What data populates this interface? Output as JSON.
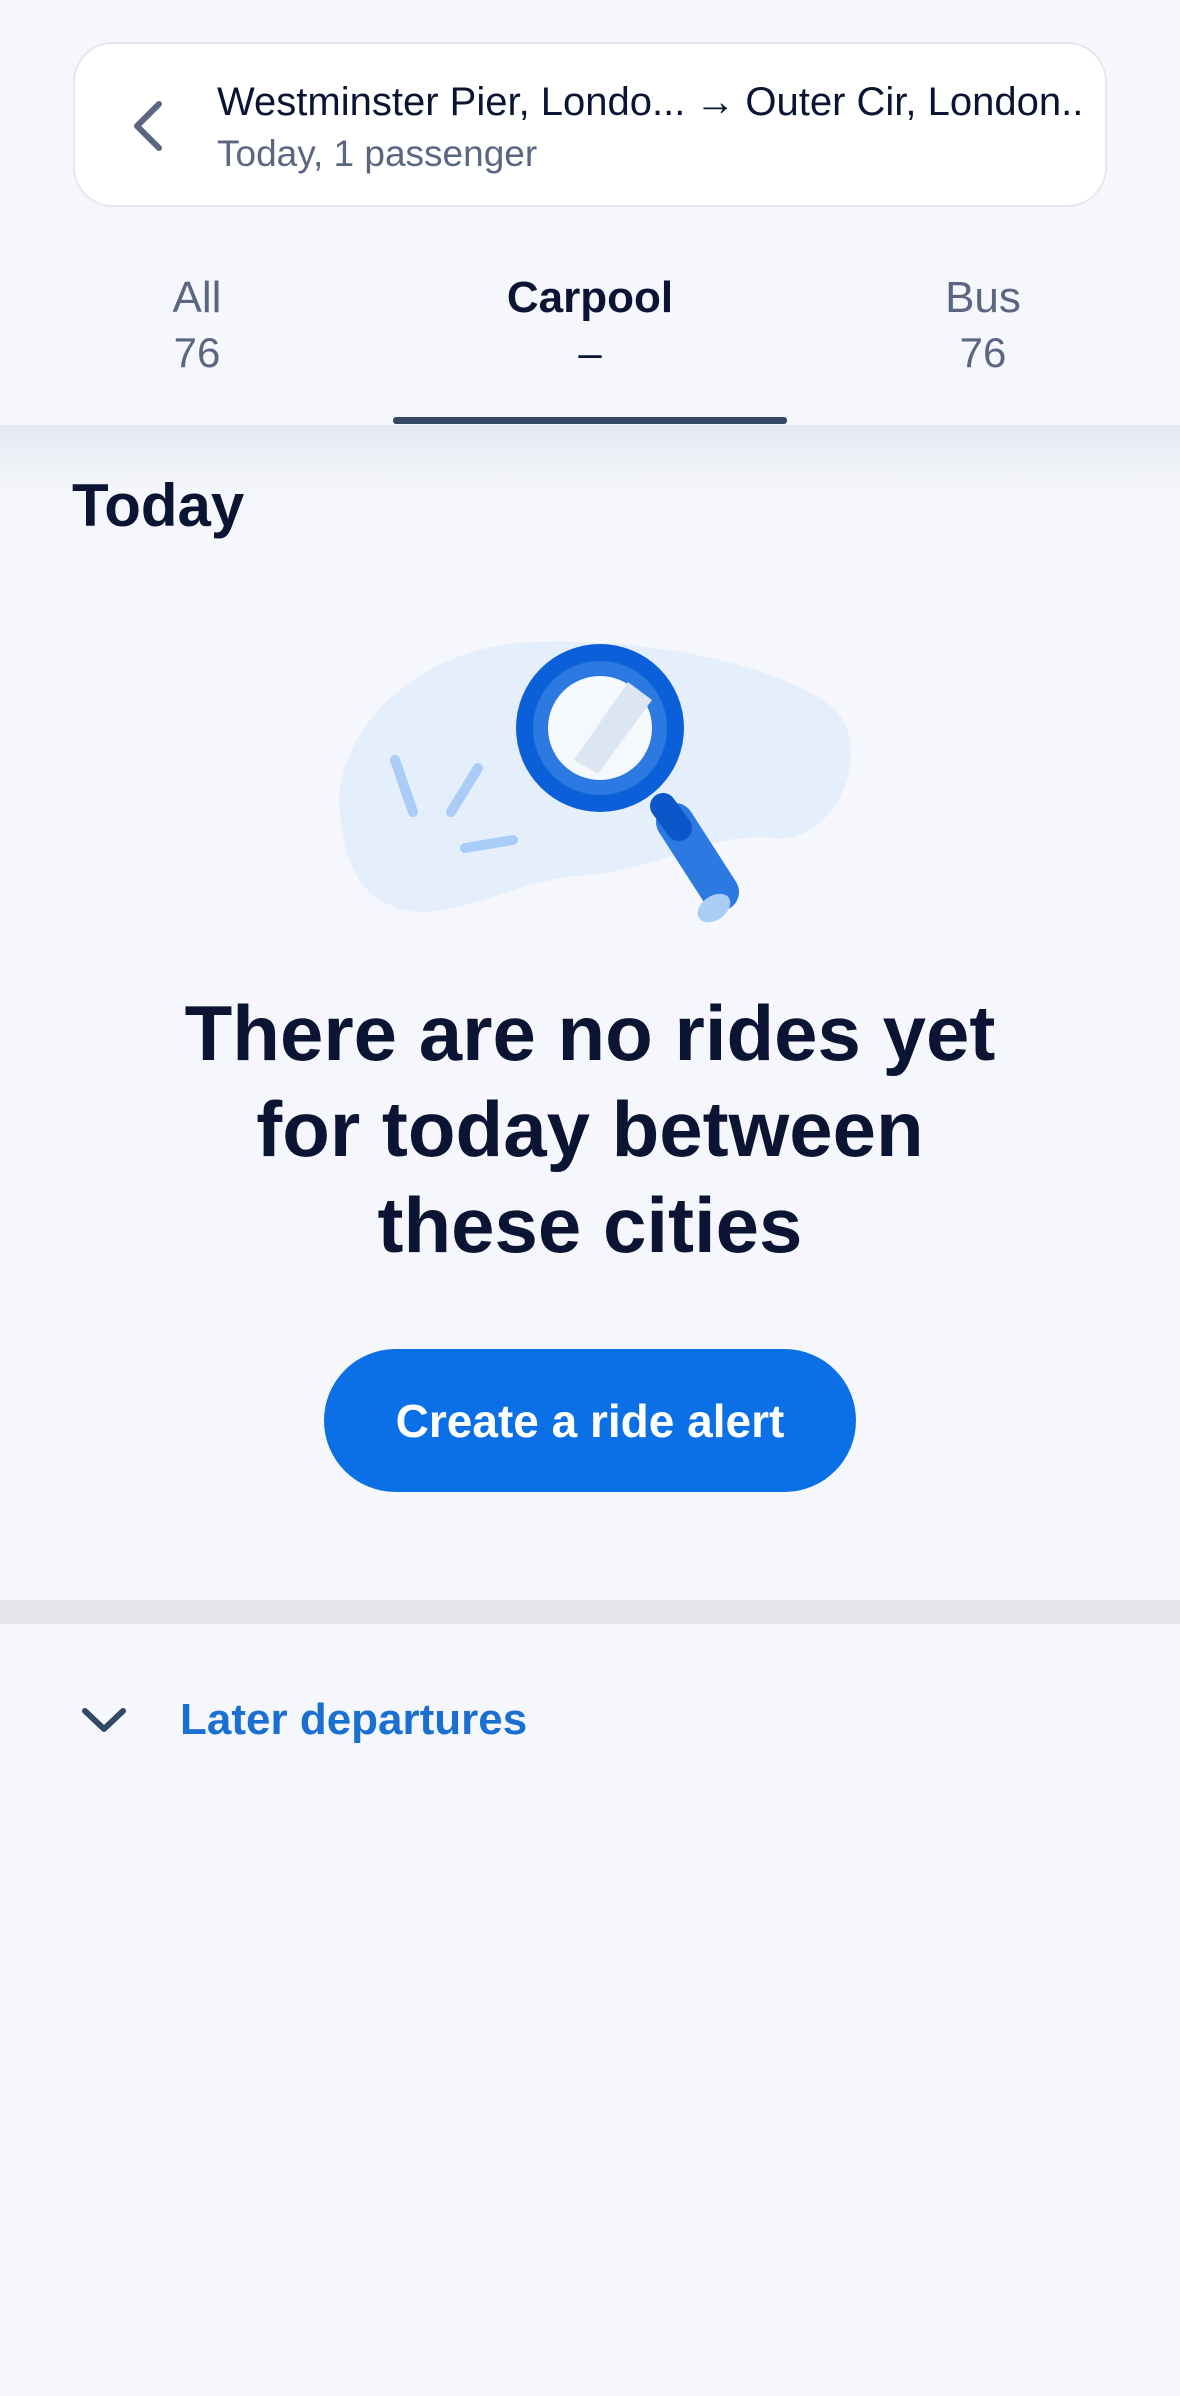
{
  "search": {
    "from": "Westminster Pier, Londo...",
    "arrow": "→",
    "to": "Outer Cir, London...",
    "details": "Today, 1 passenger"
  },
  "tabs": [
    {
      "label": "All",
      "count": "76",
      "active": false
    },
    {
      "label": "Carpool",
      "count": "–",
      "active": true
    },
    {
      "label": "Bus",
      "count": "76",
      "active": false
    }
  ],
  "section": {
    "title": "Today"
  },
  "empty_state": {
    "title_lines": [
      "There are no rides yet",
      "for today between",
      "these cities"
    ],
    "button_label": "Create a ride alert"
  },
  "later": {
    "label": "Later departures"
  },
  "colors": {
    "primary": "#0b6fe5",
    "link": "#1a6fd1",
    "text_dark": "#0b1533",
    "text_muted": "#5b6780",
    "background": "#f5f7fc",
    "tab_indicator": "#354866"
  },
  "icons": {
    "back": "chevron-left-icon",
    "expand": "chevron-down-icon",
    "illustration": "magnifying-glass-icon"
  }
}
